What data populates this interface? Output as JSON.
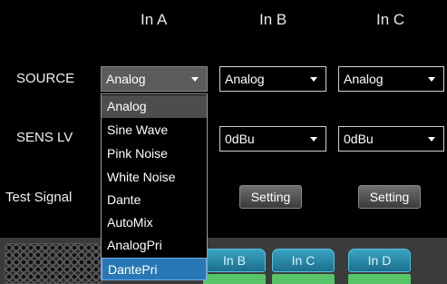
{
  "columns": [
    "In A",
    "In B",
    "In C"
  ],
  "rows": {
    "source": "SOURCE",
    "sens": "SENS LV",
    "test": "Test Signal"
  },
  "source_select": {
    "a": "Analog",
    "b": "Analog",
    "c": "Analog"
  },
  "sens_select": {
    "b": "0dBu",
    "c": "0dBu"
  },
  "dropdown_options": [
    "Analog",
    "Sine Wave",
    "Pink Noise",
    "White Noise",
    "Dante",
    "AutoMix",
    "AnalogPri",
    "DantePri"
  ],
  "dropdown_selected": "Analog",
  "dropdown_hovered": "DantePri",
  "buttons": {
    "setting_b": "Setting",
    "setting_c": "Setting"
  },
  "bottom_tabs": [
    "In B",
    "In C",
    "In D"
  ],
  "colors": {
    "tab": "#2a8fb0",
    "hover": "#2a77b6",
    "green": "#58c46a"
  }
}
